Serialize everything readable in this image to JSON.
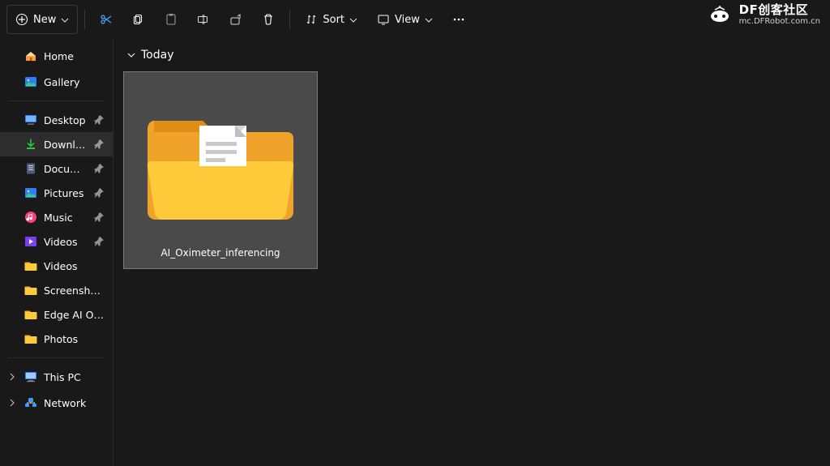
{
  "toolbar": {
    "new_label": "New",
    "sort_label": "Sort",
    "view_label": "View"
  },
  "watermark": {
    "line1": "DF创客社区",
    "line2": "mc.DFRobot.com.cn"
  },
  "sidebar": {
    "home_label": "Home",
    "gallery_label": "Gallery",
    "items_quick": [
      {
        "id": "desktop",
        "label": "Desktop",
        "pin": true,
        "icon": "desktop"
      },
      {
        "id": "downloads",
        "label": "Downloads",
        "pin": true,
        "icon": "download",
        "selected": true
      },
      {
        "id": "documents",
        "label": "Documents",
        "pin": true,
        "icon": "document"
      },
      {
        "id": "pictures",
        "label": "Pictures",
        "pin": true,
        "icon": "picture"
      },
      {
        "id": "music",
        "label": "Music",
        "pin": true,
        "icon": "music"
      },
      {
        "id": "videos",
        "label": "Videos",
        "pin": true,
        "icon": "video"
      },
      {
        "id": "videos2",
        "label": "Videos",
        "pin": false,
        "icon": "folder"
      },
      {
        "id": "screens",
        "label": "Screenshots",
        "pin": false,
        "icon": "folder"
      },
      {
        "id": "edgeai",
        "label": "Edge AI Oxymeter",
        "pin": false,
        "icon": "folder"
      },
      {
        "id": "photos",
        "label": "Photos",
        "pin": false,
        "icon": "folder"
      }
    ],
    "thispc_label": "This PC",
    "network_label": "Network"
  },
  "content": {
    "group_title": "Today",
    "items": [
      {
        "name": "AI_Oximeter_inferencing"
      }
    ]
  }
}
